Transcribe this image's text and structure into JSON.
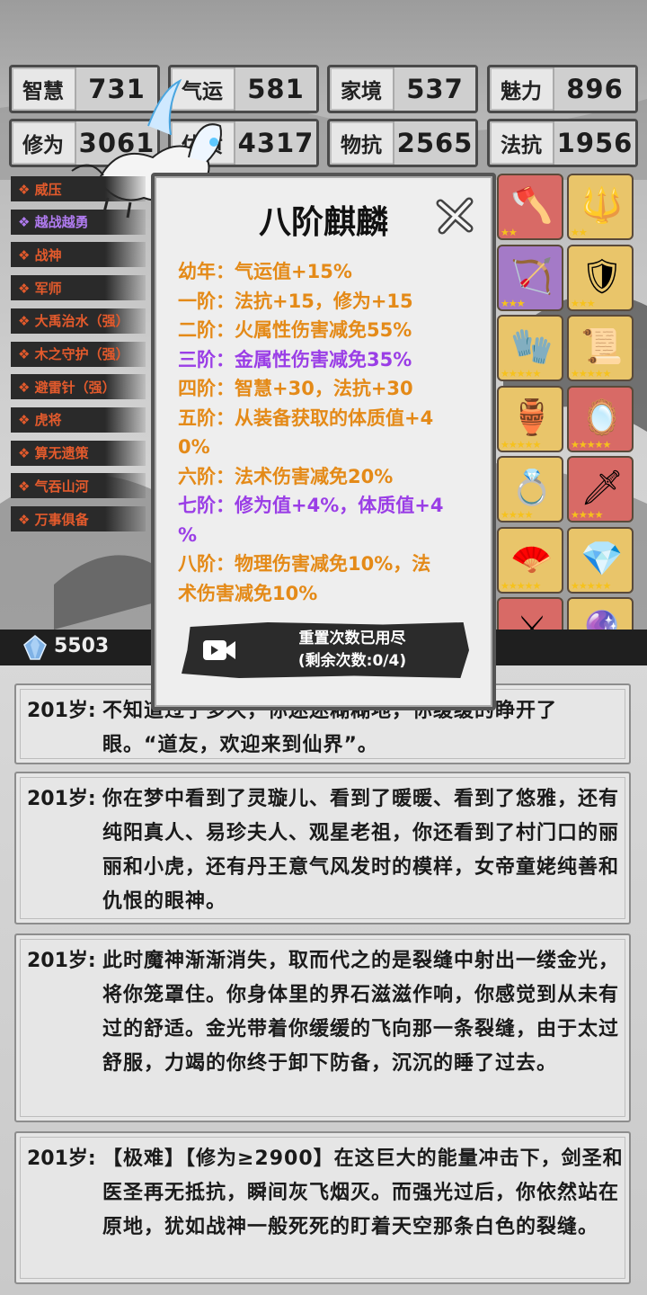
{
  "stats": [
    {
      "label": "智慧",
      "value": "731"
    },
    {
      "label": "气运",
      "value": "581"
    },
    {
      "label": "家境",
      "value": "537"
    },
    {
      "label": "魅力",
      "value": "896"
    },
    {
      "label": "修为",
      "value": "3061"
    },
    {
      "label": "体质",
      "value": "4317"
    },
    {
      "label": "物抗",
      "value": "2565"
    },
    {
      "label": "法抗",
      "value": "1956"
    }
  ],
  "skills": [
    {
      "label": "❖ 威压",
      "color": "red"
    },
    {
      "label": "❖ 越战越勇",
      "color": "purple"
    },
    {
      "label": "❖ 战神",
      "color": "red"
    },
    {
      "label": "❖ 军师",
      "color": "red"
    },
    {
      "label": "❖ 大禹治水（强）",
      "color": "red"
    },
    {
      "label": "❖ 木之守护（强）",
      "color": "red"
    },
    {
      "label": "❖ 避雷针（强）",
      "color": "red"
    },
    {
      "label": "❖ 虎将",
      "color": "red"
    },
    {
      "label": "❖ 算无遗策",
      "color": "red"
    },
    {
      "label": "❖ 气吞山河",
      "color": "red"
    },
    {
      "label": "❖ 万事俱备",
      "color": "red"
    }
  ],
  "items": [
    {
      "name": "axe-icon",
      "glyph": "🪓",
      "bg": "red",
      "stars": "★★"
    },
    {
      "name": "golden-scepter-icon",
      "glyph": "🔱",
      "bg": "gold",
      "stars": "★★"
    },
    {
      "name": "crossbow-icon",
      "glyph": "🏹",
      "bg": "purple",
      "stars": "★★★"
    },
    {
      "name": "blue-shield-icon",
      "glyph": "🛡",
      "bg": "gold",
      "stars": "★★★"
    },
    {
      "name": "pink-gauntlet-icon",
      "glyph": "🧤",
      "bg": "gold",
      "stars": "★★★★★"
    },
    {
      "name": "scroll-icon",
      "glyph": "📜",
      "bg": "gold",
      "stars": "★★★★★"
    },
    {
      "name": "bronze-cauldron-icon",
      "glyph": "🏺",
      "bg": "gold",
      "stars": "★★★★★"
    },
    {
      "name": "mirror-icon",
      "glyph": "🪞",
      "bg": "red",
      "stars": "★★★★★"
    },
    {
      "name": "ring-icon",
      "glyph": "💍",
      "bg": "gold",
      "stars": "★★★★"
    },
    {
      "name": "spear-icon",
      "glyph": "🗡",
      "bg": "red",
      "stars": "★★★★"
    },
    {
      "name": "fan-icon",
      "glyph": "🪭",
      "bg": "gold",
      "stars": "★★★★★"
    },
    {
      "name": "crystal-icon",
      "glyph": "💎",
      "bg": "gold",
      "stars": "★★★★★"
    },
    {
      "name": "sword-icon",
      "glyph": "⚔",
      "bg": "red",
      "stars": "★★★★"
    },
    {
      "name": "fire-orb-icon",
      "glyph": "🔮",
      "bg": "gold",
      "stars": "★★★★★"
    }
  ],
  "resource": {
    "icon": "crystal-currency-icon",
    "value": "5503"
  },
  "popup": {
    "title": "八阶麒麟",
    "lines": [
      {
        "text": "幼年：气运值+15%",
        "color": "orange"
      },
      {
        "text": "一阶：法抗+15，修为+15",
        "color": "orange"
      },
      {
        "text": "二阶：火属性伤害减免55%",
        "color": "orange"
      },
      {
        "text": "三阶：金属性伤害减免35%",
        "color": "purple"
      },
      {
        "text": "四阶：智慧+30，法抗+30",
        "color": "orange"
      },
      {
        "text": "五阶：从装备获取的体质值+4\n0%",
        "color": "orange"
      },
      {
        "text": "六阶：法术伤害减免20%",
        "color": "orange"
      },
      {
        "text": "七阶：修为值+4%，体质值+4\n%",
        "color": "purple"
      },
      {
        "text": "八阶：物理伤害减免10%，法\n术伤害减免10%",
        "color": "orange"
      }
    ],
    "reset_line1": "重置次数已用尽",
    "reset_line2": "(剩余次数:0/4)"
  },
  "log": [
    {
      "age": "201岁:",
      "text": "不知道过了多久，你迷迷糊糊地，你缓缓的睁开了眼。“道友，欢迎来到仙界”。"
    },
    {
      "age": "201岁:",
      "text": "你在梦中看到了灵璇儿、看到了暖暖、看到了悠雅，还有纯阳真人、易珍夫人、观星老祖，你还看到了村门口的丽丽和小虎，还有丹王意气风发时的模样，女帝童姥纯善和仇恨的眼神。"
    },
    {
      "age": "201岁:",
      "text": "此时魔神渐渐消失，取而代之的是裂缝中射出一缕金光，将你笼罩住。你身体里的界石滋滋作响，你感觉到从未有过的舒适。金光带着你缓缓的飞向那一条裂缝，由于太过舒服，力竭的你终于卸下防备，沉沉的睡了过去。"
    },
    {
      "age": "201岁:",
      "text": "【极难】【修为≥2900】在这巨大的能量冲击下，剑圣和医圣再无抵抗，瞬间灰飞烟灭。而强光过后，你依然站在原地，犹如战神一般死死的盯着天空那条白色的裂缝。"
    }
  ],
  "colors": {
    "orange": "#e48a18",
    "purple": "#9a3ee6",
    "skill_red": "#e35a2c",
    "skill_purple": "#b07bf0"
  }
}
